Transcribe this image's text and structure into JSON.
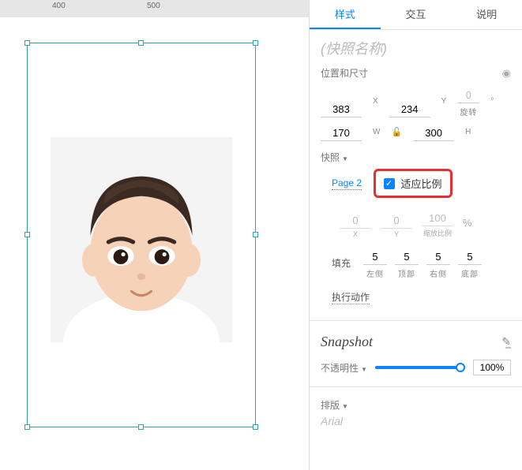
{
  "ruler": {
    "t400": "400",
    "t500": "500"
  },
  "tabs": {
    "style": "样式",
    "interact": "交互",
    "notes": "说明"
  },
  "title_placeholder": "(快照名称)",
  "pos": {
    "label": "位置和尺寸",
    "x": "383",
    "xLabel": "X",
    "y": "234",
    "yLabel": "Y",
    "rot": "0",
    "rotUnit": "°",
    "rotLabel": "旋转",
    "w": "170",
    "wLabel": "W",
    "h": "300",
    "hLabel": "H"
  },
  "snapshot": {
    "label": "快照",
    "page": "Page 2",
    "fit": "适应比例",
    "sx": "0",
    "sxLabel": "X",
    "sy": "0",
    "syLabel": "Y",
    "scale": "100",
    "scaleLabel": "缩放比例",
    "pct": "%"
  },
  "fill": {
    "label": "填充",
    "l": "5",
    "lLabel": "左侧",
    "t": "5",
    "tLabel": "顶部",
    "r": "5",
    "rLabel": "右侧",
    "b": "5",
    "bLabel": "底部"
  },
  "action": "执行动作",
  "name": {
    "title": "Snapshot"
  },
  "opacity": {
    "label": "不透明性",
    "value": "100%"
  },
  "typeset": {
    "label": "排版",
    "font": "Arial"
  }
}
